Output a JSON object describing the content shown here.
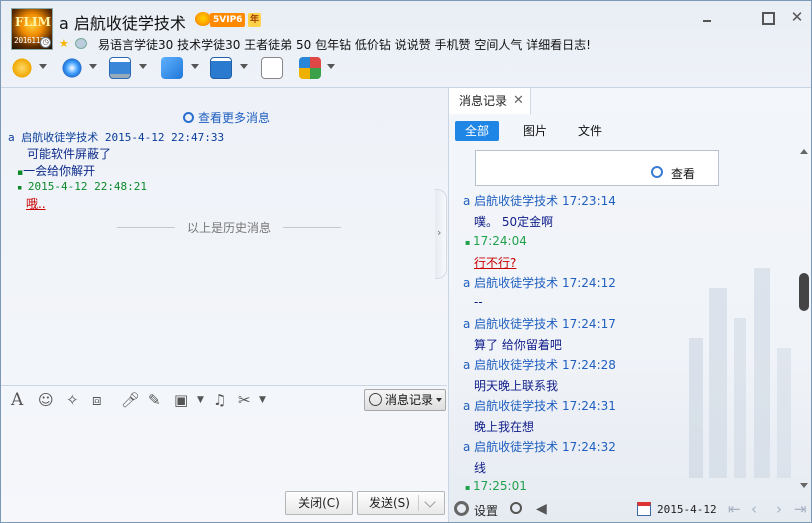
{
  "header": {
    "title": "a 启航收徒学技术",
    "vip_label": "5VIP6",
    "year_label": "年",
    "avatar_text": "2016113",
    "avatar_top": "FLIM",
    "signature": "易语言学徒30 技术学徒30 王者徒弟 50 包年钻 低价钻  说说赞 手机赞 空间人气 详细看日志!"
  },
  "toolbar": {
    "items": [
      {
        "name": "voice-call",
        "icon": "microphone-icon",
        "color": "#e0a000"
      },
      {
        "name": "video-call",
        "icon": "camera-icon",
        "color": "#2a86d8"
      },
      {
        "name": "remote-desktop",
        "icon": "screen-icon",
        "color": "#3a87d8"
      },
      {
        "name": "send-file",
        "icon": "folder-arrow-icon",
        "color": "#2b8be0"
      },
      {
        "name": "share-screen",
        "icon": "monitor-icon",
        "color": "#2a7ad0"
      },
      {
        "name": "group-chat",
        "icon": "add-chat-icon",
        "color": "#3aa04a"
      },
      {
        "name": "apps",
        "icon": "apps-grid-icon",
        "color": "#e05050"
      }
    ]
  },
  "chat": {
    "more_messages": "查看更多消息",
    "history_divider": "以上是历史消息",
    "messages": [
      {
        "head": "a 启航收徒学技术 2015-4-12 22:47:33",
        "type": "blue"
      },
      {
        "body": "可能软件屏蔽了",
        "type": "body"
      },
      {
        "body": "一会给你解开",
        "type": "body"
      },
      {
        "head": "2015-4-12 22:48:21",
        "type": "green"
      },
      {
        "body": "哦..",
        "type": "red"
      }
    ]
  },
  "input_tools": {
    "history_button": "消息记录"
  },
  "bottom": {
    "close_label": "关闭(C)",
    "send_label": "发送(S)"
  },
  "record_panel": {
    "tab_label": "消息记录",
    "filters": [
      "全部",
      "图片",
      "文件"
    ],
    "search_label": "查看",
    "messages": [
      {
        "text": "a 启航收徒学技术 17:23:14",
        "type": "head"
      },
      {
        "text": "噗。 50定金啊",
        "type": "text"
      },
      {
        "text": "17:24:04",
        "type": "green"
      },
      {
        "text": "行不行?",
        "type": "red"
      },
      {
        "text": "a 启航收徒学技术 17:24:12",
        "type": "head"
      },
      {
        "text": "--",
        "type": "text"
      },
      {
        "text": "a 启航收徒学技术 17:24:17",
        "type": "head"
      },
      {
        "text": "算了 给你留着吧",
        "type": "text"
      },
      {
        "text": "a 启航收徒学技术 17:24:28",
        "type": "head"
      },
      {
        "text": "明天晚上联系我",
        "type": "text"
      },
      {
        "text": "a 启航收徒学技术 17:24:31",
        "type": "head"
      },
      {
        "text": "晚上我在想",
        "type": "text"
      },
      {
        "text": "a 启航收徒学技术 17:24:32",
        "type": "head"
      },
      {
        "text": "线",
        "type": "text"
      },
      {
        "text": "17:25:01",
        "type": "green"
      }
    ],
    "footer": {
      "settings_label": "设置",
      "date": "2015-4-12"
    }
  }
}
